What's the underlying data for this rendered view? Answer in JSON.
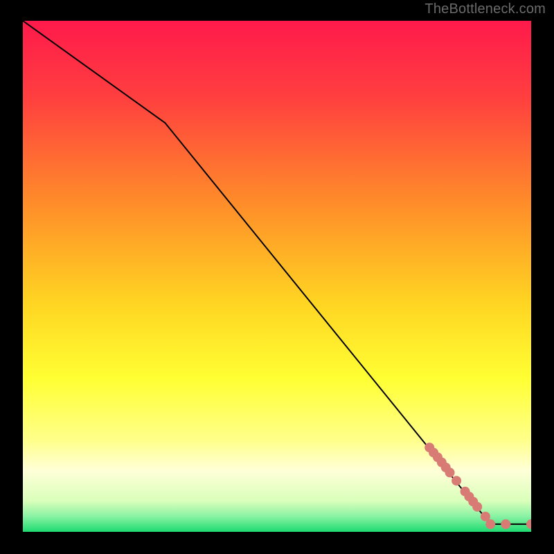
{
  "attribution": "TheBottleneck.com",
  "chart_data": {
    "type": "line",
    "title": "",
    "xlabel": "",
    "ylabel": "",
    "xlim": [
      0,
      100
    ],
    "ylim": [
      0,
      100
    ],
    "curve": [
      {
        "x": 0,
        "y": 100
      },
      {
        "x": 28,
        "y": 80
      },
      {
        "x": 92,
        "y": 1.5
      },
      {
        "x": 100,
        "y": 1.5
      }
    ],
    "markers": [
      {
        "x": 80.0,
        "y": 16.5
      },
      {
        "x": 80.8,
        "y": 15.5
      },
      {
        "x": 81.6,
        "y": 14.6
      },
      {
        "x": 82.4,
        "y": 13.6
      },
      {
        "x": 83.2,
        "y": 12.6
      },
      {
        "x": 84.0,
        "y": 11.6
      },
      {
        "x": 85.3,
        "y": 10.0
      },
      {
        "x": 87.0,
        "y": 7.9
      },
      {
        "x": 87.8,
        "y": 6.9
      },
      {
        "x": 88.6,
        "y": 5.9
      },
      {
        "x": 89.4,
        "y": 4.9
      },
      {
        "x": 91.0,
        "y": 3.0
      },
      {
        "x": 92.0,
        "y": 1.5
      },
      {
        "x": 95.0,
        "y": 1.5
      },
      {
        "x": 100.0,
        "y": 1.5
      }
    ],
    "gradient_stops": [
      {
        "offset": 0.0,
        "color": "#ff1a4b"
      },
      {
        "offset": 0.15,
        "color": "#ff3f3f"
      },
      {
        "offset": 0.35,
        "color": "#ff8a2a"
      },
      {
        "offset": 0.55,
        "color": "#ffd422"
      },
      {
        "offset": 0.7,
        "color": "#ffff33"
      },
      {
        "offset": 0.82,
        "color": "#ffff8a"
      },
      {
        "offset": 0.88,
        "color": "#ffffd8"
      },
      {
        "offset": 0.94,
        "color": "#d9ffba"
      },
      {
        "offset": 0.97,
        "color": "#88f2a3"
      },
      {
        "offset": 1.0,
        "color": "#1edb70"
      }
    ],
    "curve_color": "#000000",
    "marker_color": "#d97b75",
    "marker_radius": 7
  }
}
